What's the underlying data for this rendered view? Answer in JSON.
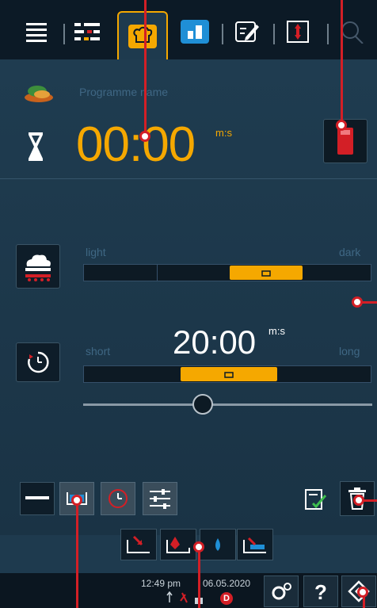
{
  "topbar": {
    "tabs": [
      {
        "name": "menu",
        "icon": "menu-icon"
      },
      {
        "name": "filters",
        "icon": "filter-icon"
      },
      {
        "name": "cooking",
        "icon": "chef-hat-icon",
        "active": true
      },
      {
        "name": "dashboard",
        "icon": "dashboard-icon"
      },
      {
        "name": "edit",
        "icon": "edit-icon"
      },
      {
        "name": "transfer",
        "icon": "transfer-icon"
      },
      {
        "name": "search",
        "icon": "search-icon"
      }
    ]
  },
  "header": {
    "program_name_placeholder": "Programme name"
  },
  "timer": {
    "value": "00:00",
    "unit": "m:s"
  },
  "browning": {
    "level_left": "light",
    "level_right": "dark",
    "level_fraction": 0.6
  },
  "cooking_time": {
    "value": "20:00",
    "unit": "m:s",
    "level_left": "short",
    "level_right": "long",
    "level_fraction": 0.45,
    "slider_fraction": 0.42
  },
  "status": {
    "time": "12:49 pm",
    "date": "06.05.2020",
    "badge": "D"
  },
  "colors": {
    "accent": "#f5a800",
    "background": "#1e3a4e",
    "topbar": "#0c1a26",
    "annotation": "#d31f26"
  }
}
